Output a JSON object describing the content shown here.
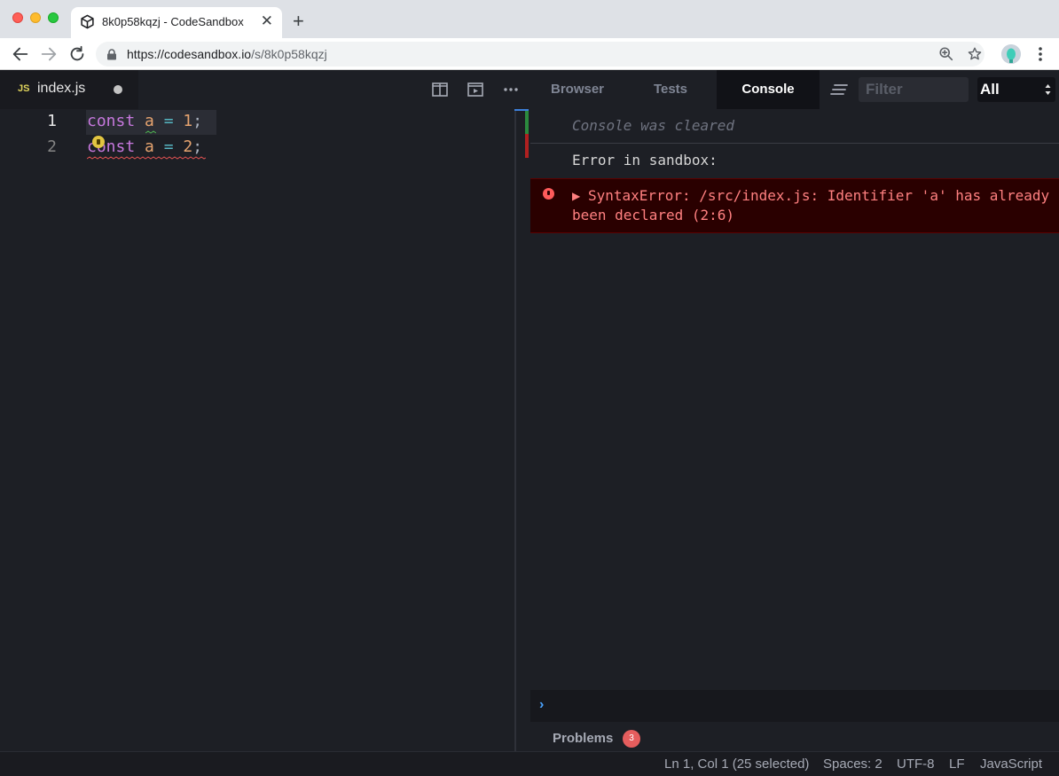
{
  "browser": {
    "tab_title": "8k0p58kqzj - CodeSandbox",
    "tab_close": "✕",
    "new_tab": "+",
    "url_host": "https://codesandbox.io",
    "url_path": "/s/8k0p58kqzj"
  },
  "editor": {
    "file_badge": "JS",
    "file_name": "index.js",
    "lines": [
      {
        "number": "1",
        "kw": "const",
        "var": "a",
        "op": "=",
        "num": "1",
        "punc": ";"
      },
      {
        "number": "2",
        "kw": "const",
        "var": "a",
        "op": "=",
        "num": "2",
        "punc": ";"
      }
    ]
  },
  "panel": {
    "tabs": {
      "browser": "Browser",
      "tests": "Tests",
      "console": "Console"
    },
    "filter_placeholder": "Filter",
    "level": "All"
  },
  "console": {
    "cleared": "Console was cleared",
    "error_heading": "Error in sandbox:",
    "error_arrow": "▶",
    "error_message": "SyntaxError: /src/index.js: Identifier 'a' has already been declared (2:6)",
    "prompt": "›"
  },
  "problems": {
    "label": "Problems",
    "count": "3"
  },
  "status": {
    "cursor": "Ln 1, Col 1 (25 selected)",
    "spaces": "Spaces: 2",
    "encoding": "UTF-8",
    "eol": "LF",
    "language": "JavaScript"
  },
  "colors": {
    "accent": "#4aa3ff",
    "error": "#ff8080",
    "error_bg": "#2a0000",
    "badge": "#e55d5d"
  },
  "icons": [
    "codesandbox-icon",
    "back-arrow-icon",
    "forward-arrow-icon",
    "reload-icon",
    "lock-icon",
    "zoom-icon",
    "star-icon",
    "avatar",
    "more-vertical-icon",
    "split-view-icon",
    "preview-icon",
    "more-horizontal-icon",
    "clear-console-icon",
    "error-icon",
    "lightbulb-icon"
  ]
}
